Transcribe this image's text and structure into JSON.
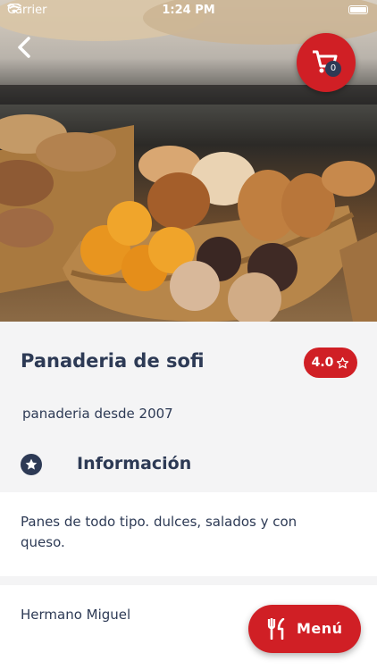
{
  "status_bar": {
    "carrier": "Carrier",
    "time": "1:24 PM"
  },
  "header": {
    "back_icon": "chevron-left-icon",
    "cart_icon": "cart-icon",
    "cart_count": "0"
  },
  "store": {
    "name": "Panaderia de sofi",
    "rating": "4.0",
    "rating_icon": "star-outline-icon",
    "subtitle": "panaderia desde 2007"
  },
  "section": {
    "icon": "star-circle-icon",
    "label": "Información"
  },
  "description": "Panes de todo tipo. dulces, salados y con queso.",
  "owner": "Hermano Miguel",
  "menu_button": {
    "icon": "fork-knife-icon",
    "label": "Menú"
  },
  "colors": {
    "accent": "#d01f25",
    "text": "#2d3a55",
    "background": "#f4f4f5"
  }
}
